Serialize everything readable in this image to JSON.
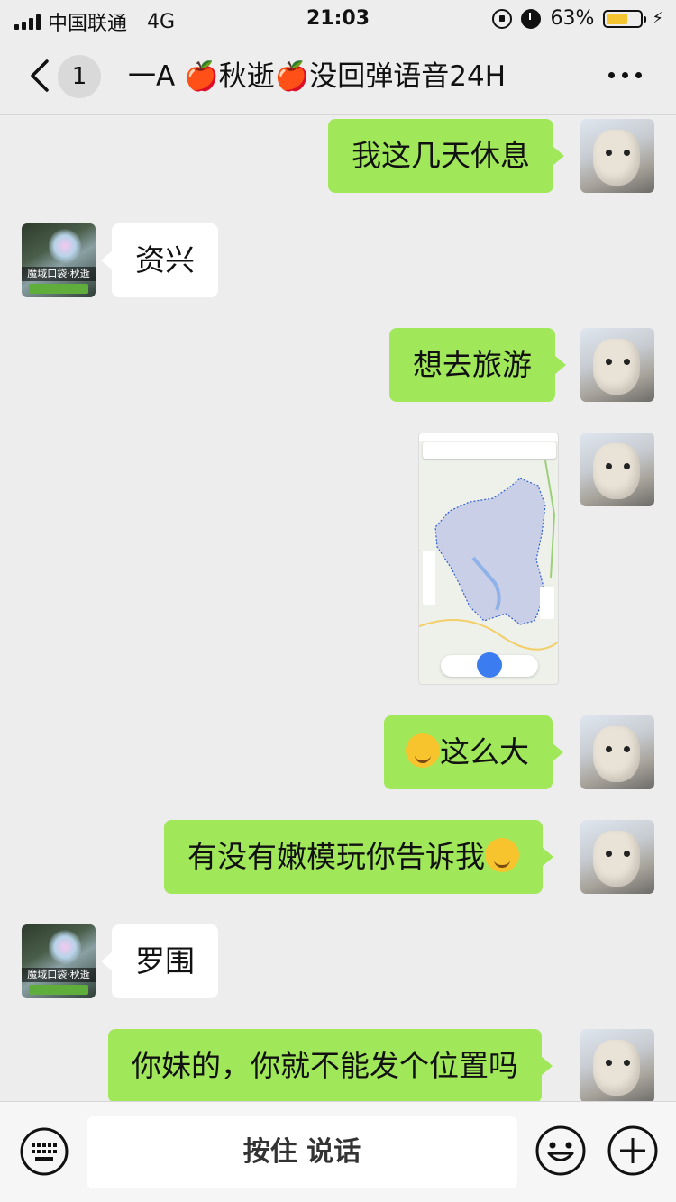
{
  "status_bar": {
    "carrier": "中国联通",
    "network": "4G",
    "time": "21:03",
    "battery_percent": "63%",
    "battery_level": 0.63,
    "icons": [
      "signal-icon",
      "rotation-lock-icon",
      "alarm-icon",
      "battery-icon",
      "charging-icon"
    ]
  },
  "nav": {
    "unread_count": "1",
    "title": "一A 🍎秋逝🍎没回弹语音24H",
    "icons": [
      "back-chevron-icon",
      "more-dots-icon"
    ]
  },
  "messages": [
    {
      "from": "me",
      "type": "text",
      "text": "我这几天休息"
    },
    {
      "from": "other",
      "type": "text",
      "text": "资兴"
    },
    {
      "from": "me",
      "type": "text",
      "text": "想去旅游"
    },
    {
      "from": "me",
      "type": "image",
      "image": "map-screenshot"
    },
    {
      "from": "me",
      "type": "text",
      "text": "这么大",
      "emoji": "sweat-smile-emoji"
    },
    {
      "from": "me",
      "type": "text",
      "text": "有没有嫩模玩你告诉我",
      "emoji": "monocle-face-emoji"
    },
    {
      "from": "other",
      "type": "text",
      "text": "罗围"
    },
    {
      "from": "me",
      "type": "text",
      "text": "你妹的，你就不能发个位置吗"
    }
  ],
  "other_avatar": {
    "caption": "魔域口袋·秋逝"
  },
  "input_bar": {
    "hold_to_talk": "按住 说话",
    "icons": [
      "keyboard-icon",
      "emoji-icon",
      "plus-icon"
    ]
  },
  "colors": {
    "background": "#ededed",
    "my_bubble": "#a0e75a",
    "other_bubble": "#ffffff",
    "battery_fill": "#f5c431"
  }
}
